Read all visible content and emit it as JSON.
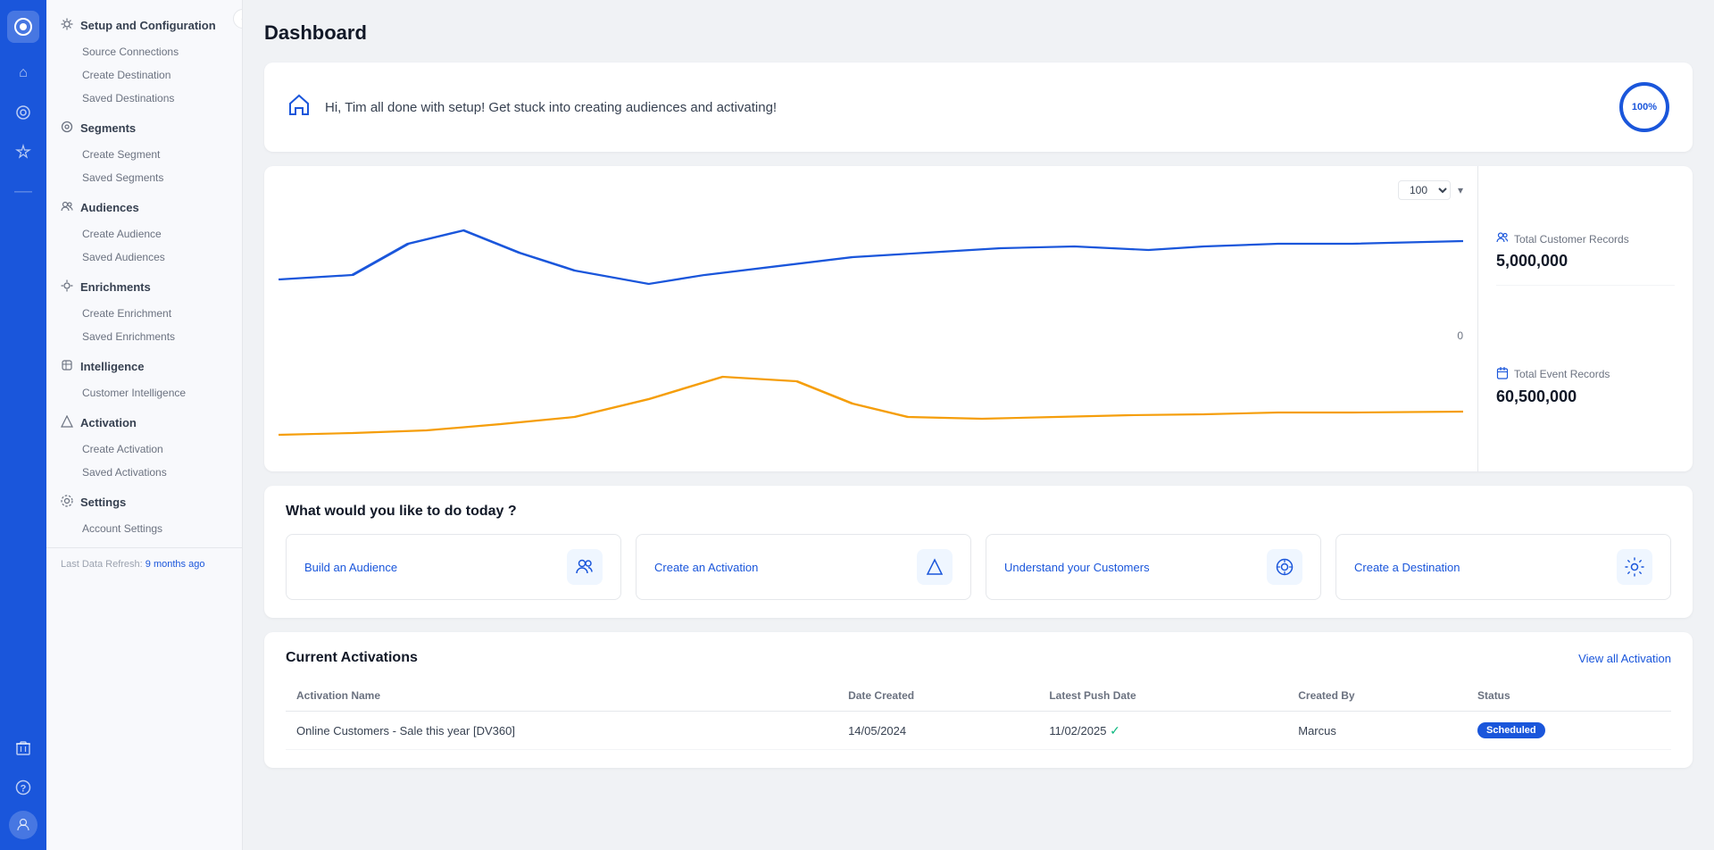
{
  "app": {
    "logo_text": "◎",
    "page_title": "Dashboard"
  },
  "icon_sidebar": {
    "icons": [
      {
        "name": "home-icon",
        "symbol": "⌂",
        "interactable": true
      },
      {
        "name": "eye-icon",
        "symbol": "◉",
        "interactable": true
      },
      {
        "name": "star-icon",
        "symbol": "✦",
        "interactable": true
      },
      {
        "name": "dash-icon",
        "symbol": "—",
        "interactable": false
      }
    ],
    "bottom_icons": [
      {
        "name": "trash-icon",
        "symbol": "🗑",
        "interactable": true
      },
      {
        "name": "help-icon",
        "symbol": "?",
        "interactable": true
      },
      {
        "name": "user-icon",
        "symbol": "👤",
        "interactable": true
      }
    ]
  },
  "sidebar": {
    "collapse_label": "‹",
    "sections": [
      {
        "id": "setup",
        "icon": "⚙",
        "label": "Setup and Configuration",
        "items": [
          {
            "label": "Source Connections",
            "name": "source-connections"
          },
          {
            "label": "Create Destination",
            "name": "create-destination"
          },
          {
            "label": "Saved Destinations",
            "name": "saved-destinations"
          }
        ]
      },
      {
        "id": "segments",
        "icon": "⊙",
        "label": "Segments",
        "items": [
          {
            "label": "Create Segment",
            "name": "create-segment"
          },
          {
            "label": "Saved Segments",
            "name": "saved-segments"
          }
        ]
      },
      {
        "id": "audiences",
        "icon": "👥",
        "label": "Audiences",
        "items": [
          {
            "label": "Create Audience",
            "name": "create-audience"
          },
          {
            "label": "Saved Audiences",
            "name": "saved-audiences"
          }
        ]
      },
      {
        "id": "enrichments",
        "icon": "⚙",
        "label": "Enrichments",
        "items": [
          {
            "label": "Create Enrichment",
            "name": "create-enrichment"
          },
          {
            "label": "Saved Enrichments",
            "name": "saved-enrichments"
          }
        ]
      },
      {
        "id": "intelligence",
        "icon": "◈",
        "label": "Intelligence",
        "items": [
          {
            "label": "Customer Intelligence",
            "name": "customer-intelligence"
          }
        ]
      },
      {
        "id": "activation",
        "icon": "△",
        "label": "Activation",
        "items": [
          {
            "label": "Create Activation",
            "name": "create-activation"
          },
          {
            "label": "Saved Activations",
            "name": "saved-activations"
          }
        ]
      },
      {
        "id": "settings",
        "icon": "👤",
        "label": "Settings",
        "items": [
          {
            "label": "Account Settings",
            "name": "account-settings"
          }
        ]
      }
    ],
    "last_refresh_label": "Last Data Refresh:",
    "last_refresh_value": "9 months ago"
  },
  "welcome": {
    "message": "Hi, Tim all done with setup! Get stuck into creating audiences and activating!",
    "progress_percent": 100,
    "progress_label": "100%"
  },
  "charts": {
    "top_chart_dropdown": "100 ▾",
    "top_chart_value_label": "100",
    "bottom_chart_value_label": "0"
  },
  "stats": [
    {
      "icon": "👥",
      "label": "Total Customer Records",
      "value": "5,000,000"
    },
    {
      "icon": "📅",
      "label": "Total Event Records",
      "value": "60,500,000"
    }
  ],
  "what_todo": {
    "title": "What would you like to do today ?",
    "actions": [
      {
        "label": "Build an Audience",
        "icon": "👤",
        "name": "build-audience-action"
      },
      {
        "label": "Create an Activation",
        "icon": "△",
        "name": "create-activation-action"
      },
      {
        "label": "Understand your Customers",
        "icon": "◎",
        "name": "understand-customers-action"
      },
      {
        "label": "Create a Destination",
        "icon": "⚙",
        "name": "create-destination-action"
      }
    ]
  },
  "activations": {
    "title": "Current Activations",
    "view_all_label": "View all Activation",
    "columns": [
      "Activation Name",
      "Date Created",
      "Latest Push Date",
      "Created By",
      "Status"
    ],
    "rows": [
      {
        "name": "Online Customers - Sale this year [DV360]",
        "date_created": "14/05/2024",
        "latest_push": "11/02/2025",
        "created_by": "Marcus",
        "status": "Scheduled"
      }
    ]
  }
}
